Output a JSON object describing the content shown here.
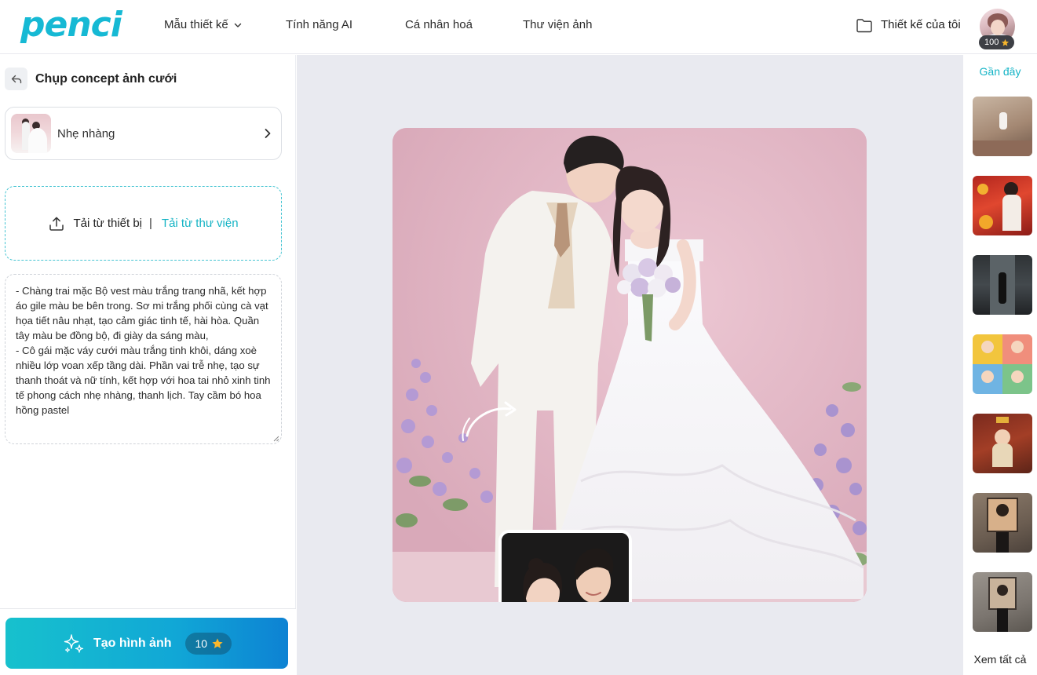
{
  "brand": {
    "logo_text": "penci",
    "accent": "#16b9d4"
  },
  "nav": {
    "items": [
      {
        "label": "Mẫu thiết kế",
        "has_dropdown": true
      },
      {
        "label": "Tính năng AI"
      },
      {
        "label": "Cá nhân hoá"
      },
      {
        "label": "Thư viện ảnh"
      }
    ],
    "my_designs": "Thiết kế của tôi",
    "coins": "100"
  },
  "panel": {
    "title": "Chụp concept ảnh cưới",
    "style_name": "Nhẹ nhàng",
    "upload_device": "Tải từ thiết bị",
    "upload_separator": "|",
    "upload_library": "Tải từ thư viện",
    "prompt": "- Chàng trai mặc Bộ vest màu trắng trang nhã, kết hợp áo gile màu be bên trong. Sơ mi trắng phối cùng cà vạt họa tiết nâu nhạt, tạo cảm giác tinh tế, hài hòa. Quần tây màu be đồng bộ, đi giày da sáng màu,\n- Cô gái mặc váy cưới màu trắng tinh khôi, dáng xoè nhiều lớp voan xếp tầng dài. Phần vai trễ nhẹ, tạo sự thanh thoát và nữ tính, kết hợp với hoa tai nhỏ xinh tinh tế phong cách nhẹ nhàng, thanh lịch. Tay cầm bó hoa hồng pastel",
    "create_label": "Tạo hình ảnh",
    "create_cost": "10"
  },
  "recent": {
    "label": "Gần đây",
    "see_all": "Xem tất cả",
    "thumbs": [
      "recent-1",
      "recent-2",
      "recent-3",
      "recent-4",
      "recent-5",
      "recent-6",
      "recent-7"
    ]
  },
  "icons": {
    "dropdown": "chevron-down-icon",
    "folder": "folder-icon",
    "coin": "star-coin-icon",
    "back": "back-arrow-icon",
    "upload": "upload-icon",
    "sparkle": "sparkle-icon"
  }
}
